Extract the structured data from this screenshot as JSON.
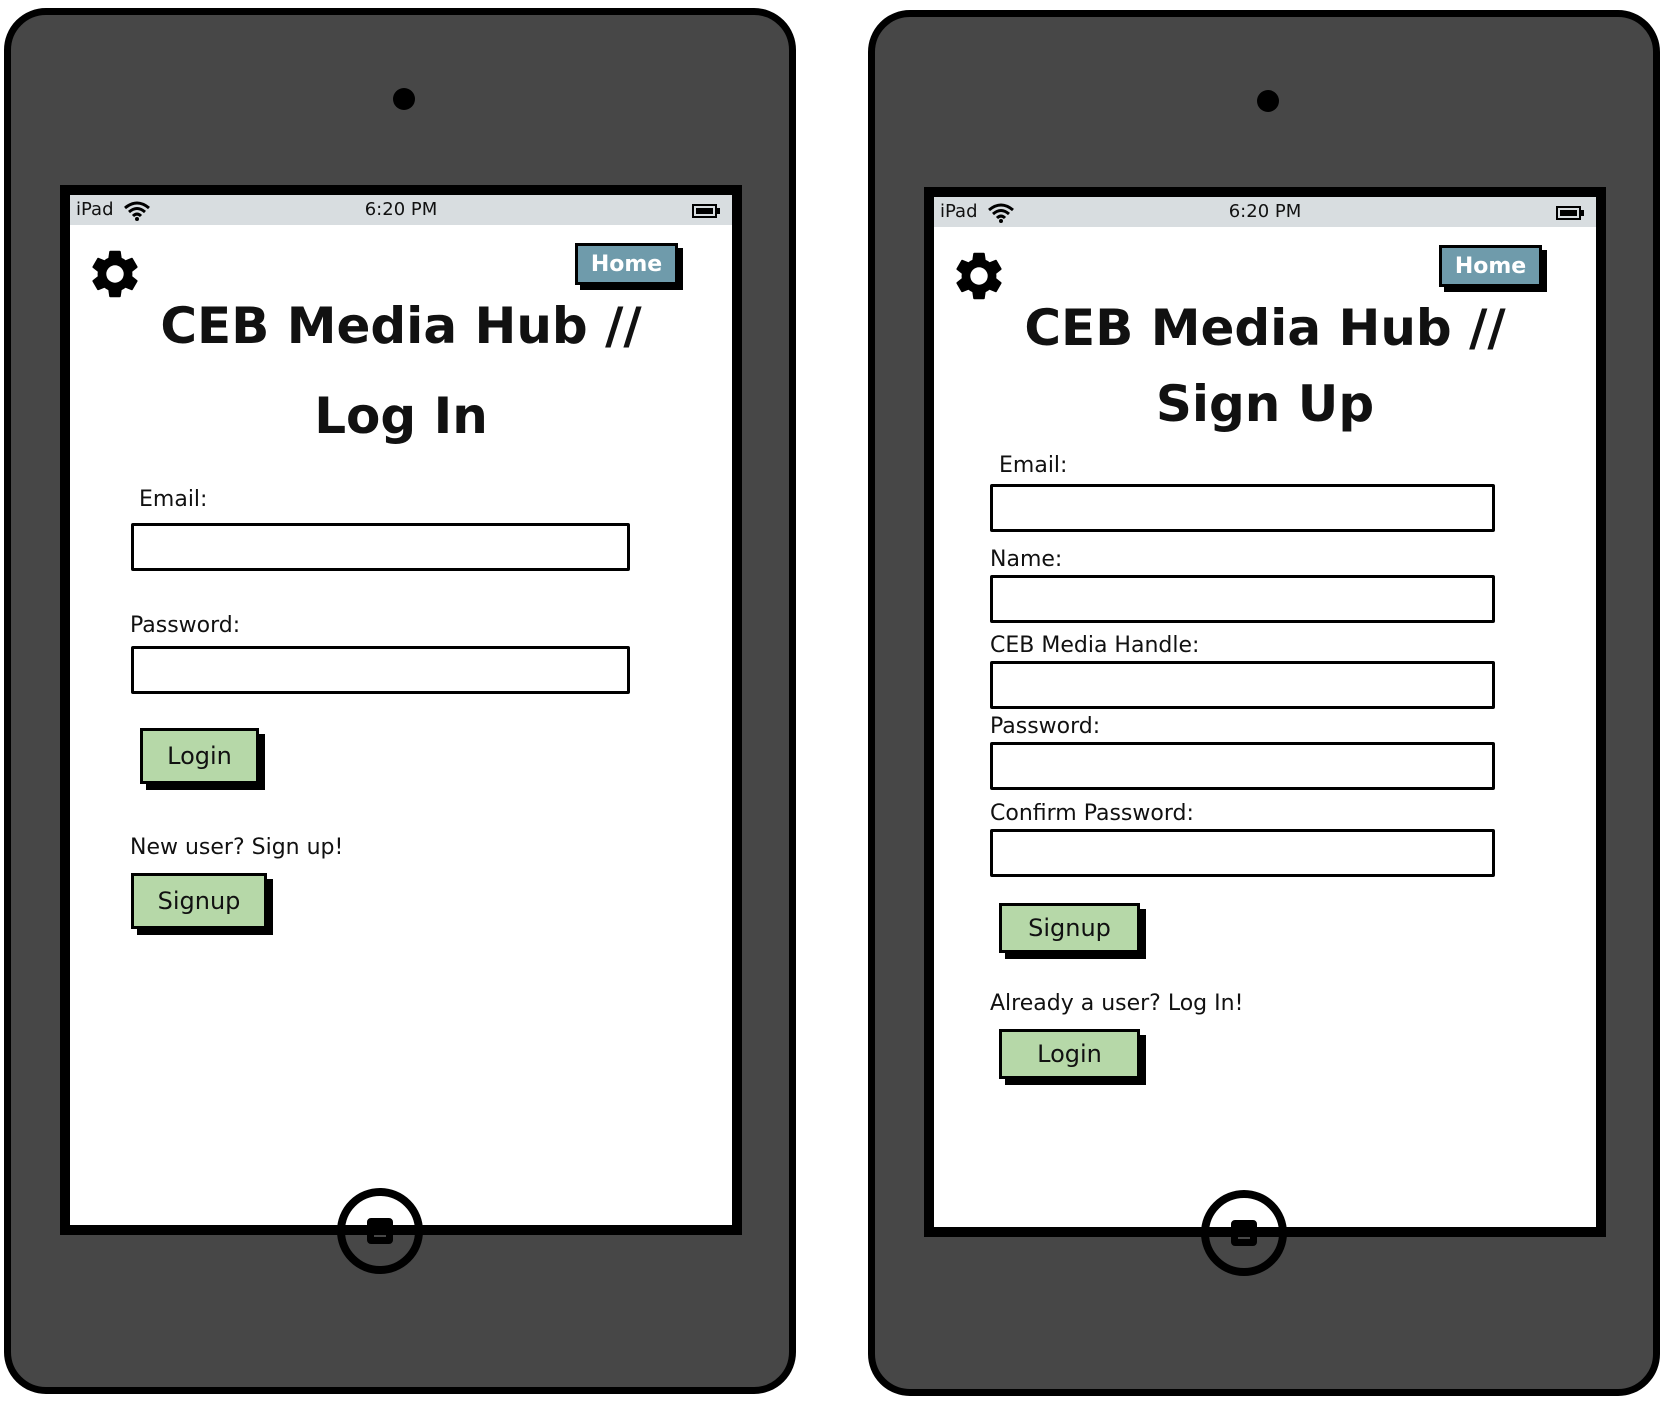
{
  "status_bar": {
    "device": "iPad",
    "time": "6:20 PM",
    "wifi_icon": "wifi-icon",
    "battery_icon": "battery-icon"
  },
  "colors": {
    "device_body": "#474747",
    "home_button": "#6f9bab",
    "action_button": "#b6d8a8",
    "status_bar": "#d8dde0"
  },
  "login_screen": {
    "settings_icon": "gear-icon",
    "home_label": "Home",
    "title_line1": "CEB Media Hub //",
    "title_line2": "Log In",
    "email_label": "Email:",
    "email_value": "",
    "password_label": "Password:",
    "password_value": "",
    "login_label": "Login",
    "signup_prompt": "New user? Sign up!",
    "signup_label": "Signup"
  },
  "signup_screen": {
    "settings_icon": "gear-icon",
    "home_label": "Home",
    "title_line1": "CEB Media Hub //",
    "title_line2": "Sign Up",
    "email_label": "Email:",
    "email_value": "",
    "name_label": "Name:",
    "name_value": "",
    "handle_label": "CEB Media Handle:",
    "handle_value": "",
    "password_label": "Password:",
    "password_value": "",
    "confirm_label": "Confirm Password:",
    "confirm_value": "",
    "signup_label": "Signup",
    "login_prompt": "Already a user? Log In!",
    "login_label": "Login"
  }
}
